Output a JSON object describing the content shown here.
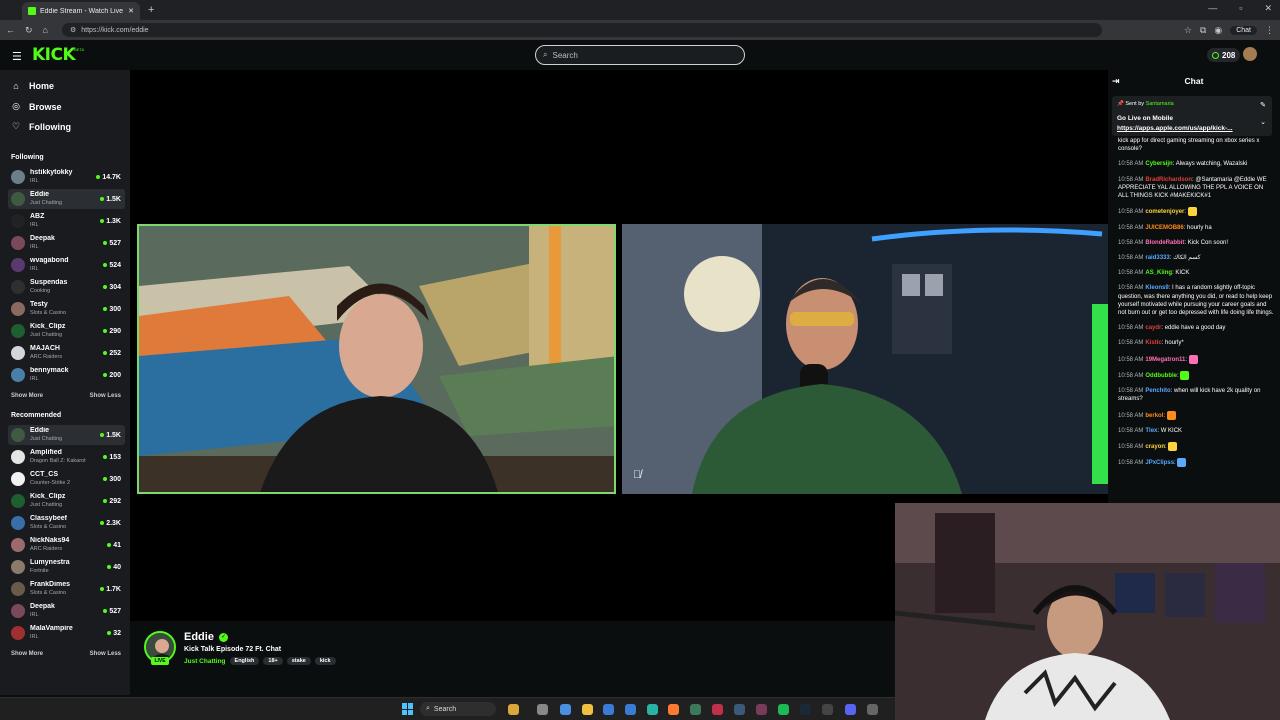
{
  "browser": {
    "tab_title": "Eddie Stream - Watch Live on",
    "url": "https://kick.com/eddie",
    "chat_chip": "Chat"
  },
  "header": {
    "logo": "KICK",
    "logo_badge": "BETA",
    "search_placeholder": "Search",
    "points": "208"
  },
  "sidebar": {
    "nav": [
      {
        "label": "Home",
        "icon": "home-icon"
      },
      {
        "label": "Browse",
        "icon": "compass-icon"
      },
      {
        "label": "Following",
        "icon": "heart-icon"
      }
    ],
    "following_title": "Following",
    "following": [
      {
        "name": "hstikkytokky",
        "category": "IRL",
        "viewers": "14.7K",
        "color": "#6b7e89"
      },
      {
        "name": "Eddie",
        "category": "Just Chatting",
        "viewers": "1.5K",
        "color": "#3e5a41"
      },
      {
        "name": "ABZ",
        "category": "IRL",
        "viewers": "1.3K",
        "color": "#222222"
      },
      {
        "name": "Deepak",
        "category": "IRL",
        "viewers": "527",
        "color": "#7a4a5a"
      },
      {
        "name": "wvagabond",
        "category": "IRL",
        "viewers": "524",
        "color": "#5a3a6e"
      },
      {
        "name": "Suspendas",
        "category": "Cooking",
        "viewers": "304",
        "color": "#2f2f2f"
      },
      {
        "name": "Testy",
        "category": "Slots & Casino",
        "viewers": "300",
        "color": "#8a6a5e"
      },
      {
        "name": "Kick_Clipz",
        "category": "Just Chatting",
        "viewers": "290",
        "color": "#1f5e2e"
      },
      {
        "name": "MAJACH",
        "category": "ARC Raiders",
        "viewers": "252",
        "color": "#d2d6da"
      },
      {
        "name": "bennymack",
        "category": "IRL",
        "viewers": "200",
        "color": "#4a7fa8"
      }
    ],
    "show_more": "Show More",
    "show_less": "Show Less",
    "recommended_title": "Recommended",
    "recommended": [
      {
        "name": "Eddie",
        "category": "Just Chatting",
        "viewers": "1.5K",
        "color": "#3e5a41"
      },
      {
        "name": "Amplified",
        "category": "Dragon Ball Z: Kakarot",
        "viewers": "153",
        "color": "#e4e4e4"
      },
      {
        "name": "CCT_CS",
        "category": "Counter-Strike 2",
        "viewers": "300",
        "color": "#f2f2f2"
      },
      {
        "name": "Kick_Clipz",
        "category": "Just Chatting",
        "viewers": "292",
        "color": "#1f5e2e"
      },
      {
        "name": "Classybeef",
        "category": "Slots & Casino",
        "viewers": "2.3K",
        "color": "#3a6ea8"
      },
      {
        "name": "NickNaks94",
        "category": "ARC Raiders",
        "viewers": "41",
        "color": "#9b6b6b"
      },
      {
        "name": "Lumynestra",
        "category": "Fortnite",
        "viewers": "40",
        "color": "#8a7a6a"
      },
      {
        "name": "FrankDimes",
        "category": "Slots & Casino",
        "viewers": "1.7K",
        "color": "#6a5a4a"
      },
      {
        "name": "Deepak",
        "category": "IRL",
        "viewers": "527",
        "color": "#7a4a5a"
      },
      {
        "name": "MalaVampire",
        "category": "IRL",
        "viewers": "32",
        "color": "#a03030"
      }
    ]
  },
  "stream": {
    "name": "Eddie",
    "title": "Kick Talk Episode 72 Ft. Chat",
    "category": "Just Chatting",
    "tags": [
      "English",
      "18+",
      "stake",
      "kick"
    ],
    "live_badge": "LIVE"
  },
  "chat": {
    "title": "Chat",
    "pinned": {
      "sent_by_label": "Sent by",
      "sent_by_user": "Santamaria",
      "heading": "Go Live on Mobile",
      "link": "https://apps.apple.com/us/app/kick-..."
    },
    "messages": [
      {
        "time": "",
        "user": "",
        "color": "#ffffff",
        "text": "kick app for direct gaming streaming on xbox series x console?"
      },
      {
        "time": "10:58 AM",
        "user": "Cybersijn",
        "color": "#53fc18",
        "text": "Always watching, Wazalski"
      },
      {
        "time": "10:58 AM",
        "user": "BradRichardson",
        "color": "#e0413a",
        "text": "@Santamaria @Eddie WE APPRECIATE YAL ALLOWING THE PPL A VOICE ON ALL THINGS KICK #MAKEKICK#1"
      },
      {
        "time": "10:58 AM",
        "user": "cometenjoyer",
        "color": "#ffd23f",
        "text": ""
      },
      {
        "time": "10:58 AM",
        "user": "JUICEMOB86",
        "color": "#ff8c1a",
        "text": "hourly ha"
      },
      {
        "time": "10:58 AM",
        "user": "BlondeRabbit",
        "color": "#ff6fb5",
        "text": "Kick Con soon!"
      },
      {
        "time": "10:58 AM",
        "user": "raid3333",
        "color": "#5aa9ff",
        "text": "كسم الكاك"
      },
      {
        "time": "10:58 AM",
        "user": "AS_Kiing",
        "color": "#53fc18",
        "text": "KICK"
      },
      {
        "time": "10:58 AM",
        "user": "Kleons9",
        "color": "#5aa9ff",
        "text": "I has a random slightly off-topic question, was there anything you did, or read to help keep yourself motivated while pursuing your career goals and not burn out or get too depressed with life doing life things."
      },
      {
        "time": "10:58 AM",
        "user": "caydr",
        "color": "#e0413a",
        "text": "eddie have a good day"
      },
      {
        "time": "10:58 AM",
        "user": "Kistic",
        "color": "#e0413a",
        "text": "hourly*"
      },
      {
        "time": "10:58 AM",
        "user": "19Megatron11",
        "color": "#ff6fb5",
        "text": ""
      },
      {
        "time": "10:58 AM",
        "user": "Oddbubble",
        "color": "#53fc18",
        "text": ""
      },
      {
        "time": "10:58 AM",
        "user": "Penchito",
        "color": "#5aa9ff",
        "text": "when will kick have 2k quality on streams?"
      },
      {
        "time": "10:58 AM",
        "user": "berkol",
        "color": "#ff8c1a",
        "text": ""
      },
      {
        "time": "10:58 AM",
        "user": "Tlex",
        "color": "#5aa9ff",
        "text": "W KICK"
      },
      {
        "time": "10:58 AM",
        "user": "crayon",
        "color": "#ffd23f",
        "text": ""
      },
      {
        "time": "10:58 AM",
        "user": "JPxClipss",
        "color": "#5aa9ff",
        "text": ""
      }
    ]
  },
  "taskbar": {
    "search_label": "Search"
  }
}
